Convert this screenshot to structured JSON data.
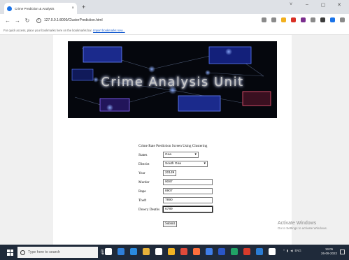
{
  "browser": {
    "tab_title": "Crime Prediction & Analysis",
    "tab_close": "×",
    "new_tab": "+",
    "url": "127.0.0.1:8000/ClusterPrediction.html",
    "bookmark_text": "For quick access, place your bookmarks here on the bookmarks bar.",
    "bookmark_link": "Import bookmarks now...",
    "window_controls": [
      "˅",
      "–",
      "▢",
      "✕"
    ],
    "extension_colors": [
      "#8a8a8a",
      "#8a8a8a",
      "#f2b01e",
      "#d93025",
      "#7b2e8e",
      "#8a8a8a",
      "#3c3c3c",
      "#1a73e8",
      "#8a8a8a"
    ]
  },
  "banner": {
    "title": "Crime Analysis Unit"
  },
  "form": {
    "heading": "Crime Rate Prediction Screen Using Clustering",
    "fields": [
      {
        "label": "States",
        "value": "Goa",
        "type": "select"
      },
      {
        "label": "District",
        "value": "South Goa",
        "type": "select"
      },
      {
        "label": "Year",
        "value": "2014",
        "type": "select"
      },
      {
        "label": "Murder",
        "value": "9087",
        "type": "text"
      },
      {
        "label": "Rape",
        "value": "8907",
        "type": "text"
      },
      {
        "label": "Theft",
        "value": "7890",
        "type": "text"
      },
      {
        "label": "Dowry Deaths",
        "value": "6789",
        "type": "text"
      }
    ],
    "submit_label": "Submit"
  },
  "watermark": {
    "line1": "Activate Windows",
    "line2": "Go to Settings to activate Windows."
  },
  "taskbar": {
    "search_placeholder": "Type here to search",
    "app_colors": [
      "#ffffff",
      "#2f7fd8",
      "#2a8be0",
      "#e8b23a",
      "#ffffff",
      "#f0b323",
      "#e04a3a",
      "#ff6f3c",
      "#3f7ee8",
      "#2a56c6",
      "#21a366",
      "#d83b2b",
      "#2b7cd3",
      "#ffffff"
    ],
    "clock_time": "19:05",
    "clock_date": "26-09-2022",
    "tray_text": "ENG"
  }
}
